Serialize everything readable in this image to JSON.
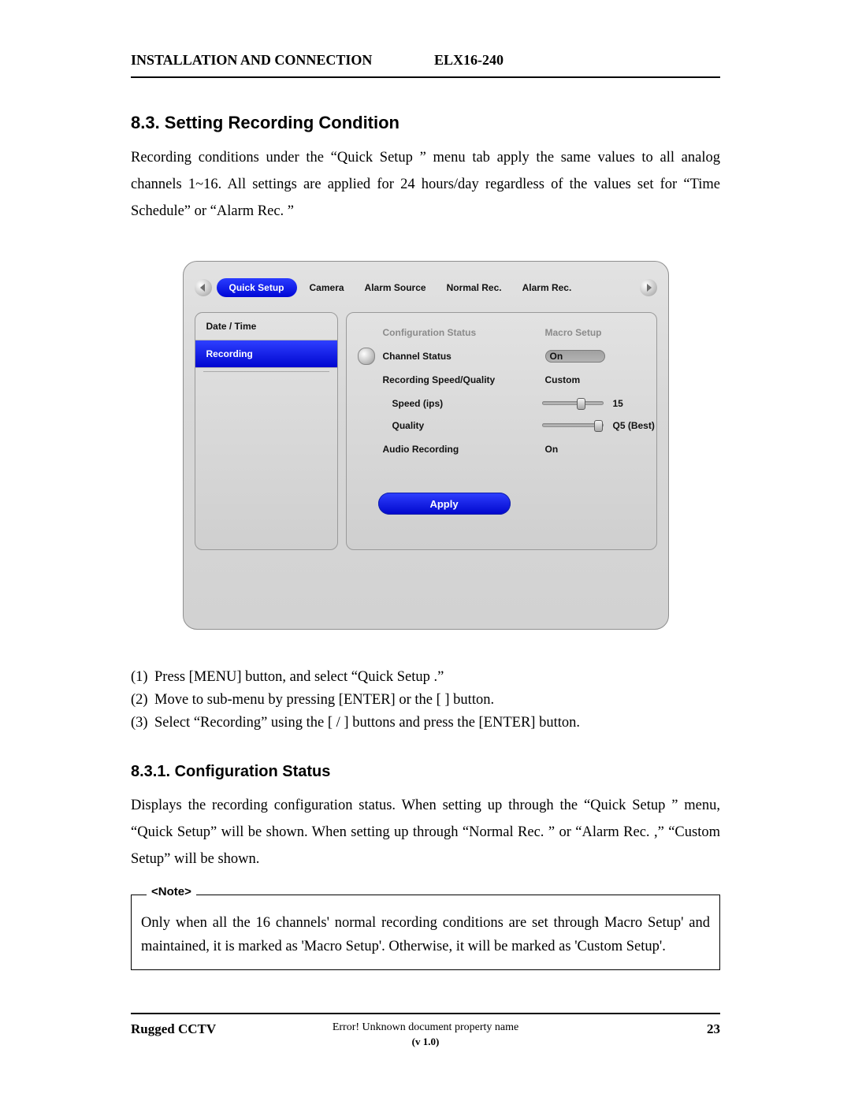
{
  "header": {
    "left": "INSTALLATION AND CONNECTION",
    "right": "ELX16-240"
  },
  "section": {
    "num_title": "8.3.  Setting Recording Condition",
    "intro": "Recording conditions under the “Quick Setup ” menu tab apply the same values to all analog channels 1~16. All settings are applied for 24 hours/day regardless of the values set for “Time Schedule” or “Alarm Rec. ”"
  },
  "ui": {
    "tabs": [
      "Quick Setup",
      "Camera",
      "Alarm Source",
      "Normal Rec.",
      "Alarm Rec."
    ],
    "active_tab": 0,
    "sidebar": {
      "items": [
        "Date / Time",
        "Recording"
      ],
      "active": 1
    },
    "rows": {
      "config_status": "Configuration Status",
      "macro_setup": "Macro Setup",
      "channel_status": "Channel Status",
      "channel_status_val": "On",
      "rsq": "Recording Speed/Quality",
      "rsq_val": "Custom",
      "speed": "Speed (ips)",
      "speed_val": "15",
      "quality": "Quality",
      "quality_val": "Q5 (Best)",
      "audio": "Audio Recording",
      "audio_val": "On",
      "apply": "Apply"
    }
  },
  "steps": [
    "Press [MENU] button, and select “Quick Setup .”",
    "Move to sub-menu by pressing [ENTER] or the [   ] button.",
    "Select “Recording” using the [   /   ] buttons and press the [ENTER] button."
  ],
  "subsection": {
    "title": "8.3.1.   Configuration Status",
    "body": "Displays the recording configuration status. When setting up through the “Quick Setup ” menu, “Quick Setup” will be shown. When setting up through “Normal Rec. ” or “Alarm Rec. ,” “Custom Setup” will be shown."
  },
  "note": {
    "label": "<Note>",
    "body": "Only when all the 16 channels' normal recording conditions are set through Macro Setup' and maintained, it is marked as 'Macro Setup'. Otherwise, it will be marked as 'Custom Setup'."
  },
  "footer": {
    "left": "Rugged CCTV",
    "mid1": "Error! Unknown document property name",
    "mid2": "(v 1.0)",
    "right": "23"
  }
}
